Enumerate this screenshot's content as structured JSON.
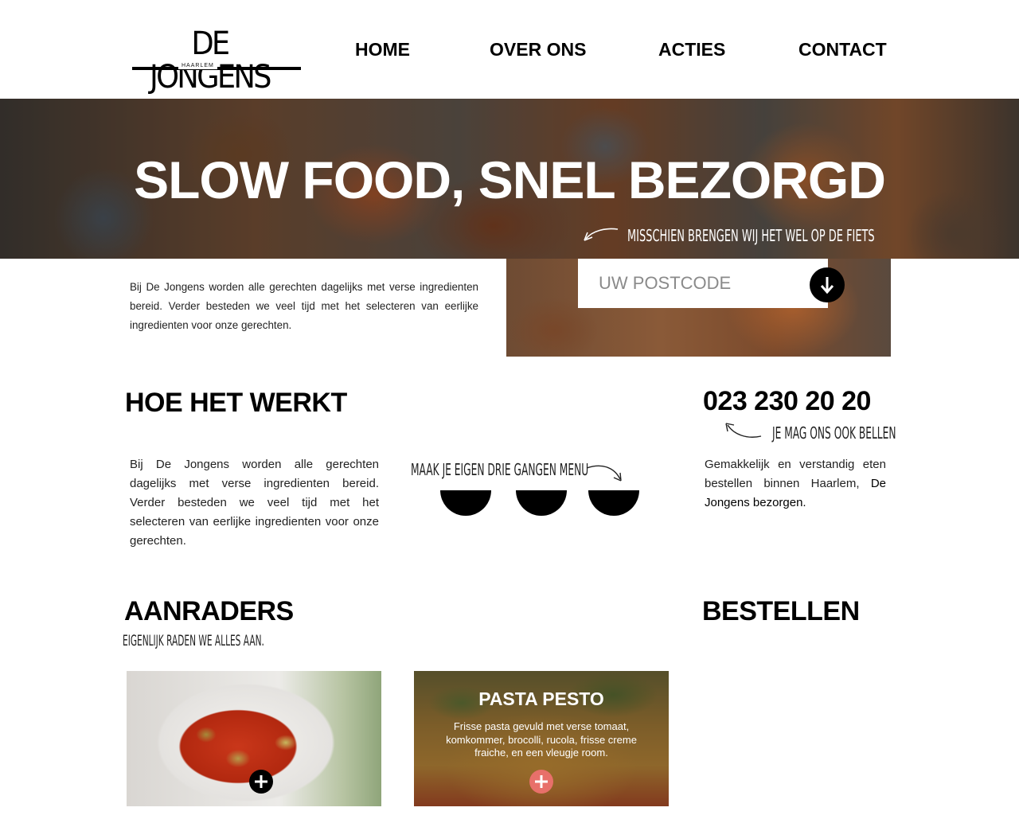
{
  "header": {
    "logo": {
      "main": "DE JONGENS",
      "sub": "HAARLEM"
    },
    "nav": [
      {
        "label": "HOME"
      },
      {
        "label": "OVER ONS"
      },
      {
        "label": "ACTIES"
      },
      {
        "label": "CONTACT"
      }
    ]
  },
  "hero": {
    "title": "SLOW FOOD, SNEL BEZORGD",
    "subtitle": "MISSCHIEN BRENGEN WIJ HET WEL OP DE FIETS"
  },
  "intro": {
    "text": "Bij De Jongens worden alle gerechten dagelijks met verse ingredienten bereid. Verder besteden we veel tijd met het selecteren van eerlijke ingredienten voor onze gerechten.",
    "postcode_placeholder": "UW POSTCODE",
    "submit_icon": "arrow-down-icon"
  },
  "how_it_works": {
    "title": "HOE HET WERKT",
    "text": "Bij De Jongens worden alle gerechten dagelijks met verse ingredienten bereid. Verder besteden we veel tijd met het selecteren van eerlijke ingredienten voor onze gerechten.",
    "menu_label": "MAAK JE EIGEN DRIE GANGEN MENU"
  },
  "contact": {
    "phone": "023 230 20 20",
    "call_label": "JE MAG ONS OOK BELLEN",
    "text_prefix": "Gemakkelijk en verstandig eten bestellen binnen Haarlem, ",
    "text_highlight": "De Jongens bezorgen."
  },
  "recommendations": {
    "title": "AANRADERS",
    "subtitle": "EIGENLIJK RADEN WE ALLES AAN.",
    "cards": [
      {
        "title": "",
        "description": ""
      },
      {
        "title": "PASTA PESTO",
        "description": "Frisse pasta gevuld met verse tomaat, komkommer, brocolli, rucola, frisse creme fraiche, en een vleugje room."
      }
    ]
  },
  "order": {
    "title": "BESTELLEN"
  },
  "colors": {
    "accent_plus": "#e8706a",
    "text": "#111111",
    "background": "#ffffff"
  }
}
